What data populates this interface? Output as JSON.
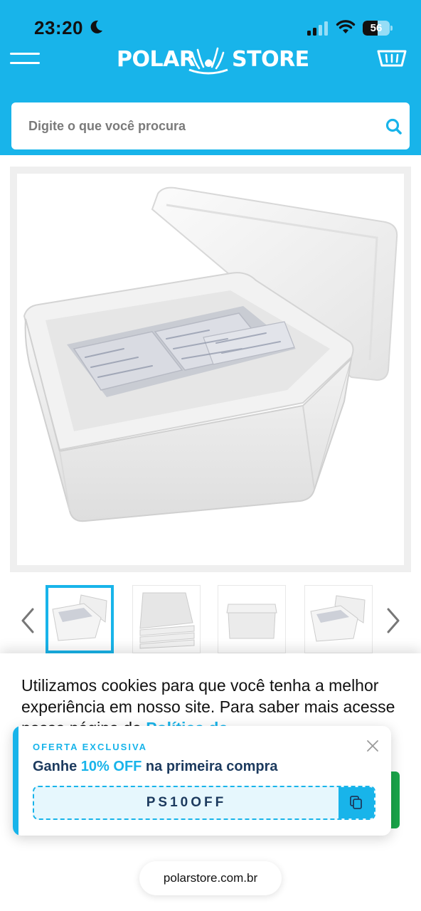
{
  "status_bar": {
    "time": "23:20",
    "battery_level": "56",
    "battery_fraction": 0.56,
    "icons": [
      "moon-icon",
      "signal-icon",
      "wifi-icon",
      "battery-icon"
    ]
  },
  "header": {
    "brand_left": "POLAR",
    "brand_right": "STORE",
    "menu_icon": "hamburger-icon",
    "cart_icon": "basket-icon",
    "accent_color": "#18b4ea"
  },
  "search": {
    "placeholder": "Digite o que você procura",
    "icon": "search-icon"
  },
  "product": {
    "main_image": "white styrofoam cooler box with lid and ice packs",
    "thumbnails": [
      {
        "alt": "Cooler with ice packs",
        "active": true
      },
      {
        "alt": "Styrofoam panels",
        "active": false
      },
      {
        "alt": "Closed cooler",
        "active": false
      },
      {
        "alt": "Open cooler",
        "active": false
      }
    ]
  },
  "cookie_banner": {
    "text": "Utilizamos cookies para que você tenha a melhor experiência em nosso site. Para saber mais",
    "partial_text": "acesse nossa página de",
    "link": "Política de",
    "accept_color": "#1aa64a"
  },
  "coupon": {
    "eyebrow": "OFERTA EXCLUSIVA",
    "headline_prefix": "Ganhe ",
    "headline_highlight": "10% OFF",
    "headline_suffix": " na primeira compra",
    "code": "PS10OFF",
    "close_icon": "close-icon",
    "copy_icon": "copy-icon"
  },
  "browser": {
    "url": "polarstore.com.br"
  }
}
